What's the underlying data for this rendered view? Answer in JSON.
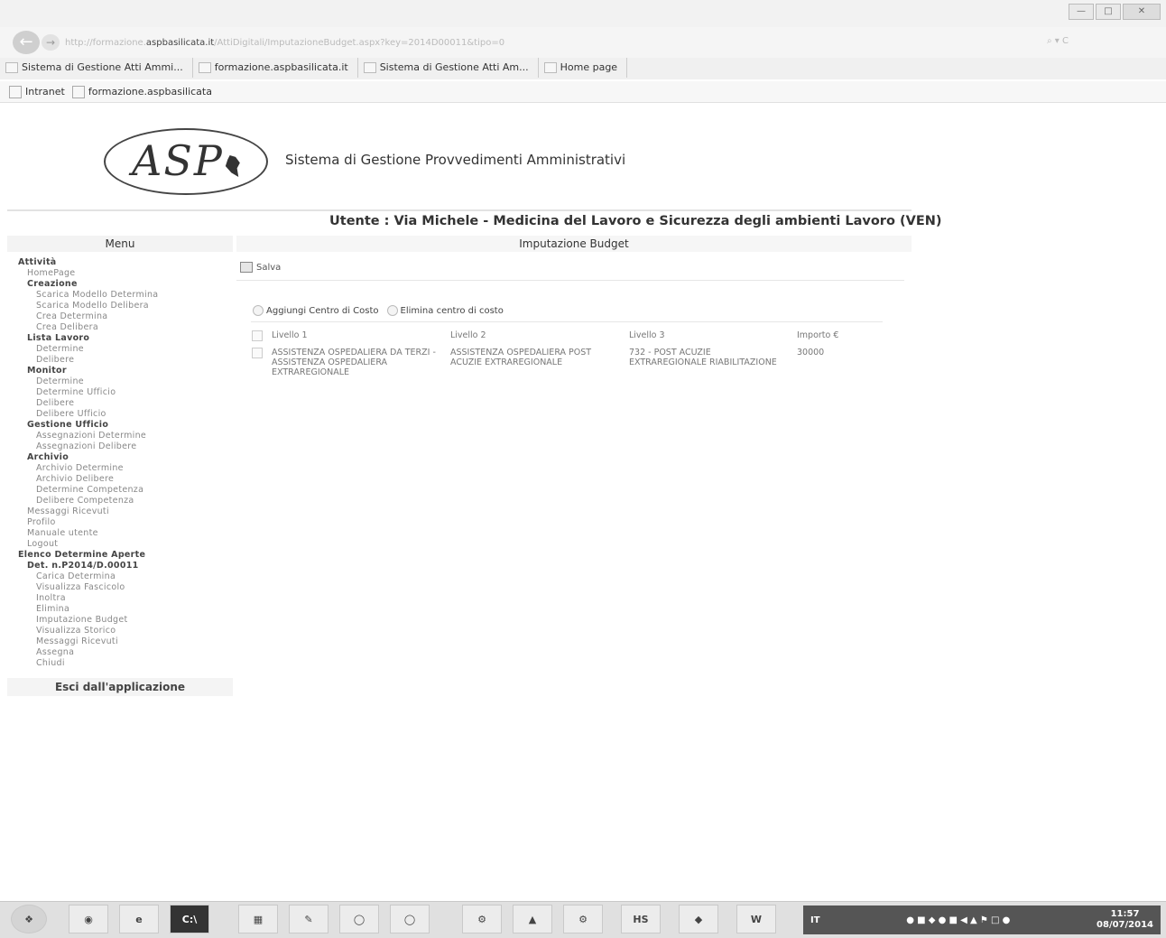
{
  "browser": {
    "address": "http://formazione.aspbasilicata.it/AttiDigitali/ImputazioneBudget.aspx?key=2014D00011&tipo=0",
    "address_host": "aspbasilicata.it",
    "address_pre": "http://formazione.",
    "address_post": "/AttiDigitali/ImputazioneBudget.aspx?key=2014D00011&tipo=0",
    "search_ctrl": "⌕ ▾ C",
    "tabs": [
      "Sistema di Gestione Atti Ammi...",
      "formazione.aspbasilicata.it",
      "Sistema di Gestione Atti Am...",
      "Home page"
    ],
    "favorites": [
      "Intranet",
      "formazione.aspbasilicata"
    ]
  },
  "header": {
    "logo_text": "ASP",
    "app_title": "Sistema di Gestione Provvedimenti Amministrativi",
    "user_line": "Utente : Via Michele - Medicina del Lavoro e Sicurezza degli ambienti Lavoro (VEN)",
    "menu_title": "Menu",
    "page_title": "Imputazione Budget"
  },
  "menu": [
    {
      "label": "Attività",
      "level": "h0"
    },
    {
      "label": "HomePage",
      "level": "l1"
    },
    {
      "label": "Creazione",
      "level": "h1"
    },
    {
      "label": "Scarica Modello Determina",
      "level": "l2"
    },
    {
      "label": "Scarica Modello Delibera",
      "level": "l2"
    },
    {
      "label": "Crea Determina",
      "level": "l2"
    },
    {
      "label": "Crea Delibera",
      "level": "l2"
    },
    {
      "label": "Lista Lavoro",
      "level": "h1"
    },
    {
      "label": "Determine",
      "level": "l2"
    },
    {
      "label": "Delibere",
      "level": "l2"
    },
    {
      "label": "Monitor",
      "level": "h1"
    },
    {
      "label": "Determine",
      "level": "l2"
    },
    {
      "label": "Determine Ufficio",
      "level": "l2"
    },
    {
      "label": "Delibere",
      "level": "l2"
    },
    {
      "label": "Delibere Ufficio",
      "level": "l2"
    },
    {
      "label": "Gestione Ufficio",
      "level": "h1"
    },
    {
      "label": "Assegnazioni Determine",
      "level": "l2"
    },
    {
      "label": "Assegnazioni Delibere",
      "level": "l2"
    },
    {
      "label": "Archivio",
      "level": "h1"
    },
    {
      "label": "Archivio Determine",
      "level": "l2"
    },
    {
      "label": "Archivio Delibere",
      "level": "l2"
    },
    {
      "label": "Determine Competenza",
      "level": "l2"
    },
    {
      "label": "Delibere Competenza",
      "level": "l2"
    },
    {
      "label": "Messaggi Ricevuti",
      "level": "l1"
    },
    {
      "label": "Profilo",
      "level": "l1"
    },
    {
      "label": "Manuale utente",
      "level": "l1"
    },
    {
      "label": "Logout",
      "level": "l1"
    },
    {
      "label": "Elenco Determine Aperte",
      "level": "h0"
    },
    {
      "label": "Det. n.P2014/D.00011",
      "level": "h1"
    },
    {
      "label": "Carica Determina",
      "level": "l2"
    },
    {
      "label": "Visualizza Fascicolo",
      "level": "l2"
    },
    {
      "label": "Inoltra",
      "level": "l2"
    },
    {
      "label": "Elimina",
      "level": "l2"
    },
    {
      "label": "Imputazione Budget",
      "level": "l2"
    },
    {
      "label": "Visualizza Storico",
      "level": "l2"
    },
    {
      "label": "Messaggi Ricevuti",
      "level": "l2"
    },
    {
      "label": "Assegna",
      "level": "l2"
    },
    {
      "label": "Chiudi",
      "level": "l2"
    }
  ],
  "exit_label": "Esci dall'applicazione",
  "toolbar": {
    "save_label": "Salva"
  },
  "grid": {
    "add_label": "Aggiungi Centro di Costo",
    "delete_label": "Elimina centro di costo",
    "columns": [
      "Livello 1",
      "Livello 2",
      "Livello 3",
      "Importo €"
    ],
    "rows": [
      {
        "livello1": "ASSISTENZA OSPEDALIERA DA TERZI - ASSISTENZA OSPEDALIERA EXTRAREGIONALE",
        "livello2": "ASSISTENZA OSPEDALIERA POST ACUZIE EXTRAREGIONALE",
        "livello3": "732 - POST ACUZIE EXTRAREGIONALE RIABILITAZIONE",
        "importo": "30000"
      }
    ]
  },
  "taskbar": {
    "cmd_label": "C:\\",
    "hs_label": "HS",
    "word_label": "W",
    "lang": "IT",
    "time": "11:57",
    "date": "08/07/2014"
  }
}
